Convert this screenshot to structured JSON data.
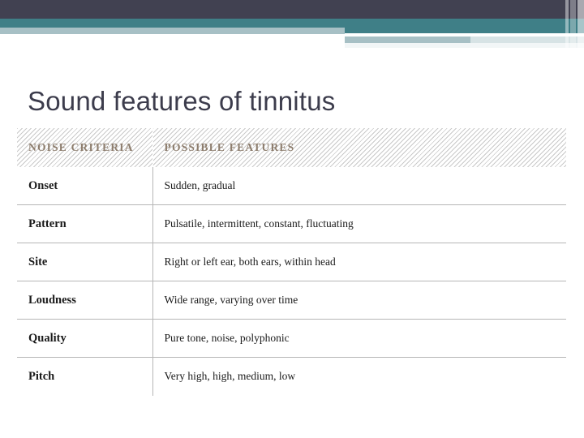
{
  "banner": {
    "colors": {
      "navy": "#414151",
      "teal": "#3f7f87",
      "steel": "#a7c0c5",
      "pale": "#d7e3e5"
    }
  },
  "slide": {
    "title": "Sound features of tinnitus",
    "title_color": "#3c3c4c"
  },
  "table": {
    "headers": [
      "NOISE CRITERIA",
      "POSSIBLE FEATURES"
    ],
    "header_text_color": "#8d7d6d",
    "rows": [
      {
        "criteria": "Onset",
        "features": "Sudden, gradual"
      },
      {
        "criteria": "Pattern",
        "features": "Pulsatile, intermittent, constant, fluctuating"
      },
      {
        "criteria": "Site",
        "features": "Right or left ear, both ears, within head"
      },
      {
        "criteria": "Loudness",
        "features": "Wide range, varying over time"
      },
      {
        "criteria": "Quality",
        "features": "Pure tone, noise, polyphonic"
      },
      {
        "criteria": "Pitch",
        "features": "Very high, high, medium, low"
      }
    ]
  }
}
